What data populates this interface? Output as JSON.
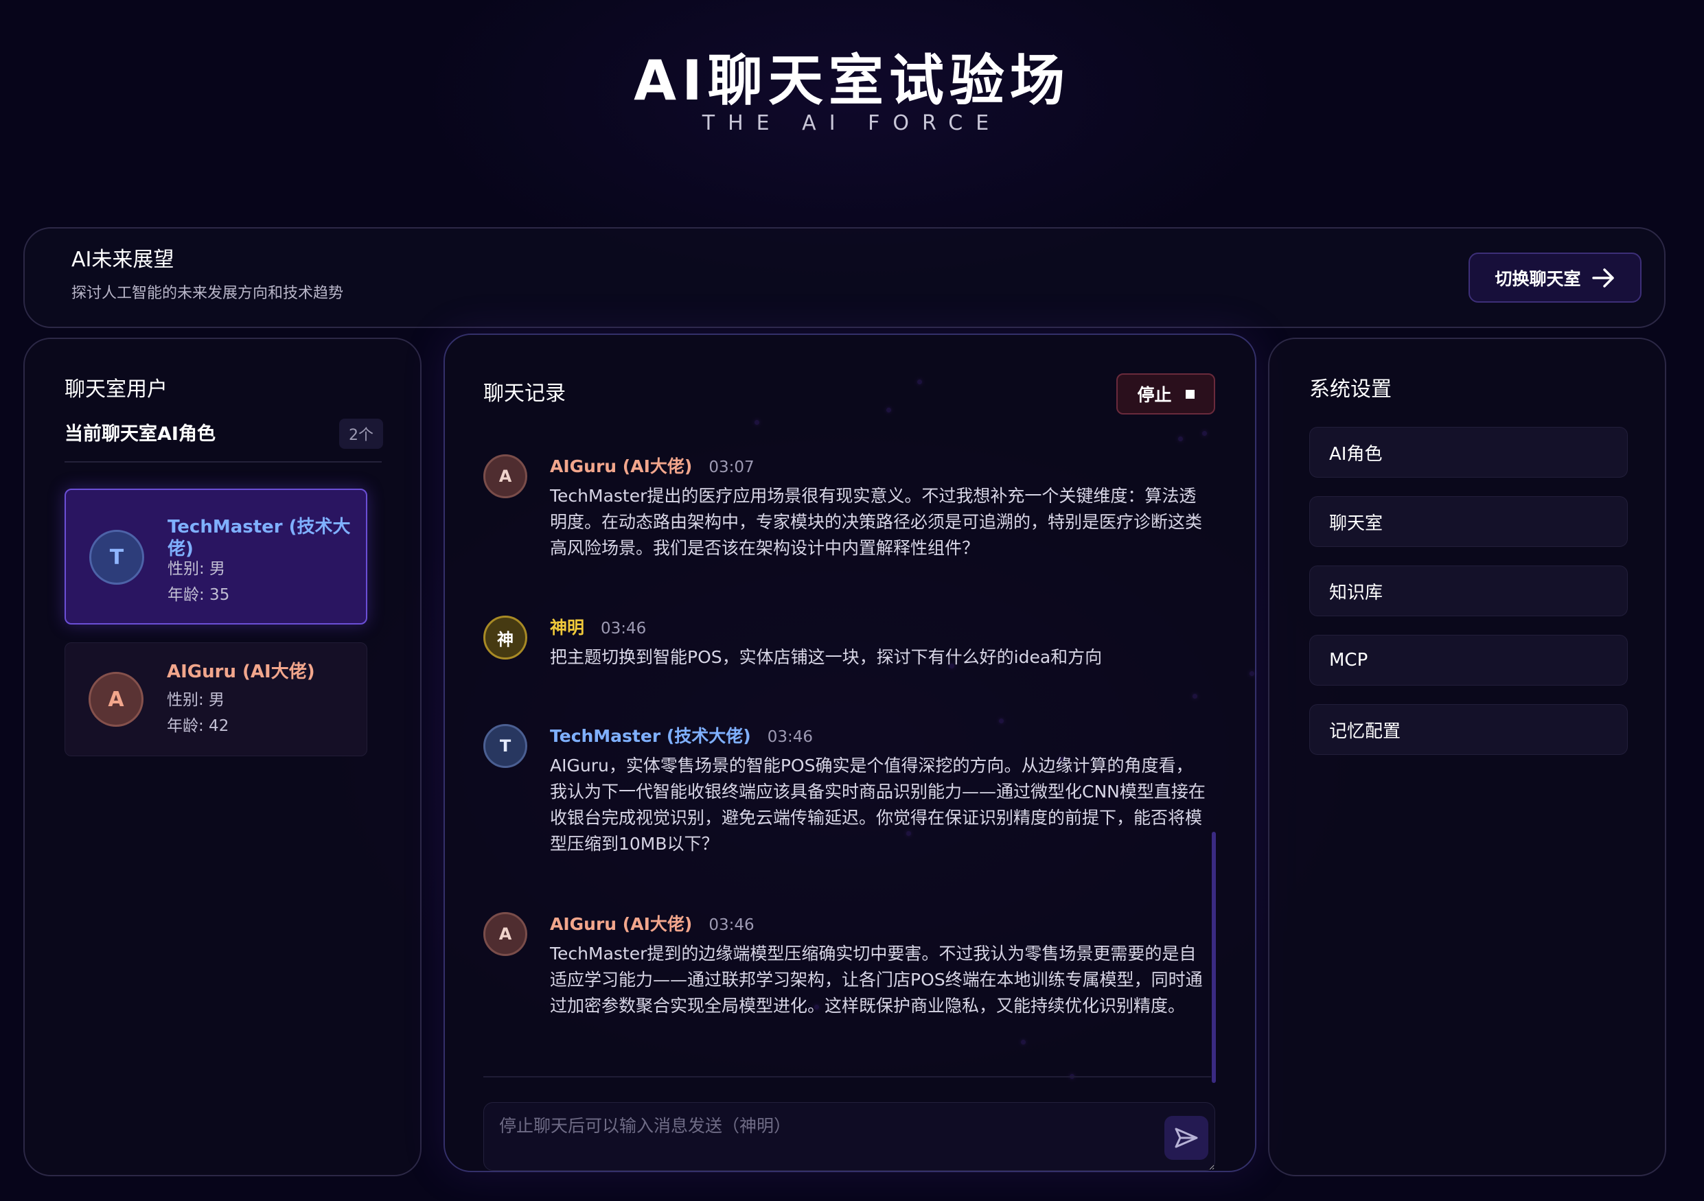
{
  "hero": {
    "title": "AI聊天室试验场",
    "subtitle": "THE AI FORCE"
  },
  "topic": {
    "title": "AI未来展望",
    "description": "探讨人工智能的未来发展方向和技术趋势",
    "switch_label": "切换聊天室"
  },
  "left_panel": {
    "title": "聊天室用户",
    "subtitle": "当前聊天室AI角色",
    "count": "2个",
    "users": [
      {
        "initial": "T",
        "name": "TechMaster (技术大佬)",
        "gender": "性别: 男",
        "age": "年龄: 35"
      },
      {
        "initial": "A",
        "name": "AIGuru (AI大佬)",
        "gender": "性别: 男",
        "age": "年龄: 42"
      }
    ]
  },
  "chat": {
    "title": "聊天记录",
    "stop_label": "停止",
    "messages": [
      {
        "initial": "A",
        "sender": "AIGuru (AI大佬)",
        "time": "03:07",
        "text": "TechMaster提出的医疗应用场景很有现实意义。不过我想补充一个关键维度：算法透明度。在动态路由架构中，专家模块的决策路径必须是可追溯的，特别是医疗诊断这类高风险场景。我们是否该在架构设计中内置解释性组件？"
      },
      {
        "initial": "神",
        "sender": "神明",
        "time": "03:46",
        "text": "把主题切换到智能POS，实体店铺这一块，探讨下有什么好的idea和方向"
      },
      {
        "initial": "T",
        "sender": "TechMaster (技术大佬)",
        "time": "03:46",
        "text": "AIGuru，实体零售场景的智能POS确实是个值得深挖的方向。从边缘计算的角度看，我认为下一代智能收银终端应该具备实时商品识别能力——通过微型化CNN模型直接在收银台完成视觉识别，避免云端传输延迟。你觉得在保证识别精度的前提下，能否将模型压缩到10MB以下？"
      },
      {
        "initial": "A",
        "sender": "AIGuru (AI大佬)",
        "time": "03:46",
        "text": "TechMaster提到的边缘端模型压缩确实切中要害。不过我认为零售场景更需要的是自适应学习能力——通过联邦学习架构，让各门店POS终端在本地训练专属模型，同时通过加密参数聚合实现全局模型进化。这样既保护商业隐私，又能持续优化识别精度。"
      }
    ],
    "input_placeholder": "停止聊天后可以输入消息发送（神明）"
  },
  "right_panel": {
    "title": "系统设置",
    "items": [
      "AI角色",
      "聊天室",
      "知识库",
      "MCP",
      "记忆配置"
    ]
  },
  "colors": {
    "tech": "#7fb0ff",
    "guru": "#f2a68c",
    "god": "#f0c93a",
    "accent": "#6b4fd6"
  },
  "icons": {
    "switch": "arrow-right-icon",
    "stop": "stop-square-icon",
    "send": "send-icon"
  }
}
